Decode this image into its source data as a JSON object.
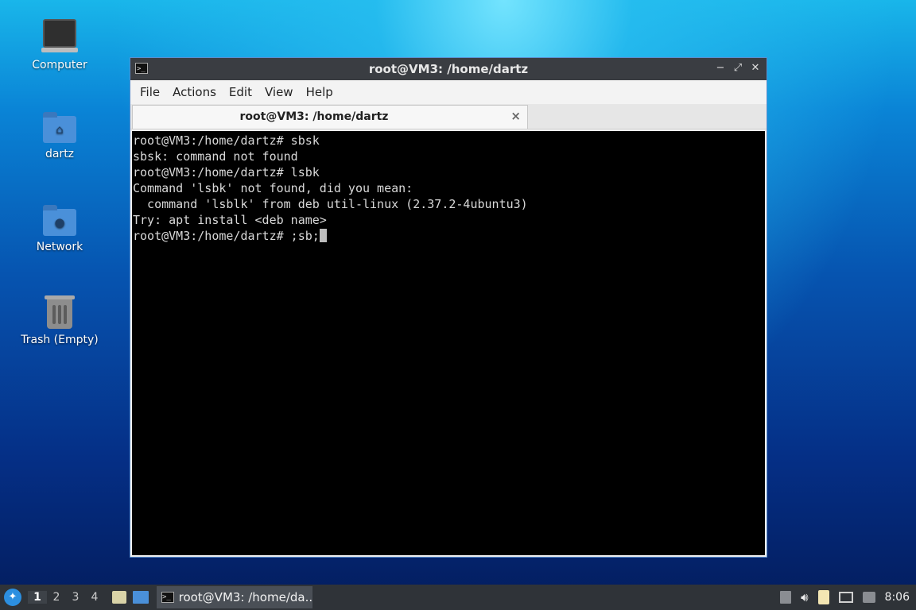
{
  "desktop": {
    "icons": [
      {
        "label": "Computer"
      },
      {
        "label": "dartz"
      },
      {
        "label": "Network"
      },
      {
        "label": "Trash (Empty)"
      }
    ]
  },
  "window": {
    "title": "root@VM3: /home/dartz",
    "menu": [
      "File",
      "Actions",
      "Edit",
      "View",
      "Help"
    ],
    "tab_label": "root@VM3: /home/dartz",
    "terminal_lines": [
      "root@VM3:/home/dartz# sbsk",
      "sbsk: command not found",
      "root@VM3:/home/dartz# lsbk",
      "Command 'lsbk' not found, did you mean:",
      "  command 'lsblk' from deb util-linux (2.37.2-4ubuntu3)",
      "Try: apt install <deb name>"
    ],
    "prompt_line": "root@VM3:/home/dartz# ;sb;"
  },
  "taskbar": {
    "workspaces": [
      "1",
      "2",
      "3",
      "4"
    ],
    "active_workspace": "1",
    "task_label": "root@VM3: /home/da...",
    "clock": "8:06"
  }
}
